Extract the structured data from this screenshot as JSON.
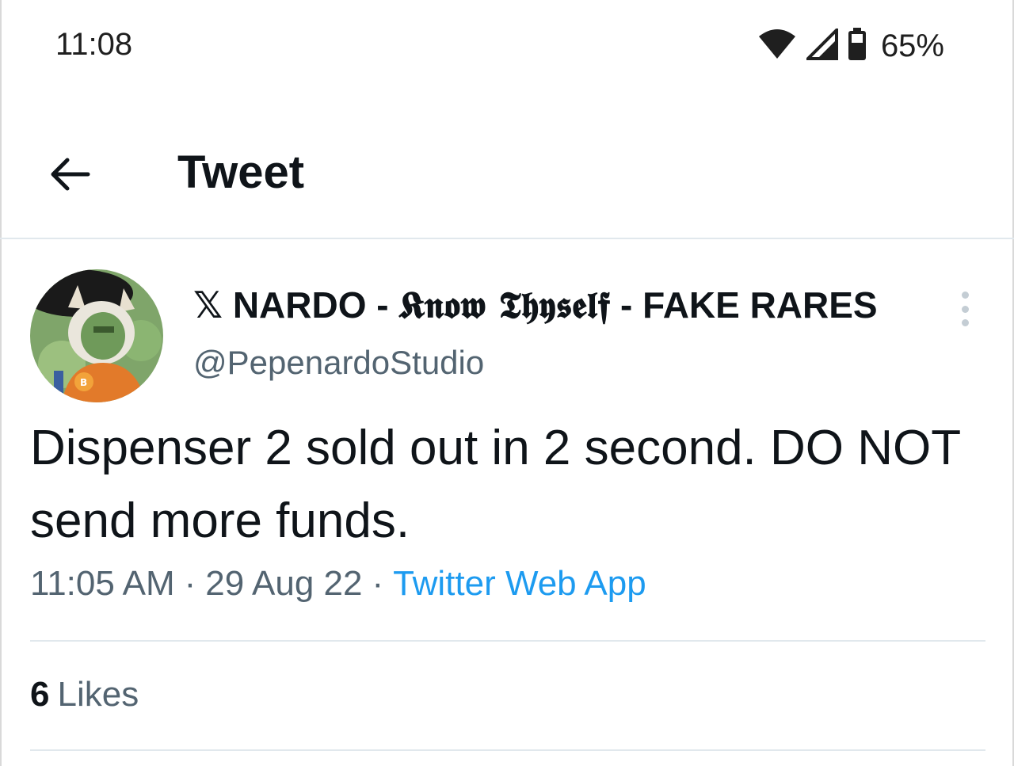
{
  "status_bar": {
    "time": "11:08",
    "battery_percent": "65%",
    "icons": [
      "wifi-icon",
      "cell-signal-icon",
      "battery-icon"
    ]
  },
  "header": {
    "title": "Tweet",
    "back_icon": "arrow-left-icon"
  },
  "tweet": {
    "display_name_prefix": "𝕏 NARDO - ",
    "display_name_frak": "𝕶𝖓𝖔𝖜 𝕿𝖍𝖞𝖘𝖊𝖑𝖋",
    "display_name_suffix": " - FAKE RARES",
    "handle": "@PepenardoStudio",
    "text": "Dispenser 2 sold out in 2 second. DO NOT send more funds.",
    "time": "11:05 AM",
    "date": "29 Aug 22",
    "separator": "·",
    "source": "Twitter Web App",
    "likes_count": "6",
    "likes_label": "Likes"
  },
  "colors": {
    "accent": "#1d9bf0",
    "secondary_text": "#536471",
    "primary_text": "#0f1419",
    "divider": "#e1e8ed"
  }
}
